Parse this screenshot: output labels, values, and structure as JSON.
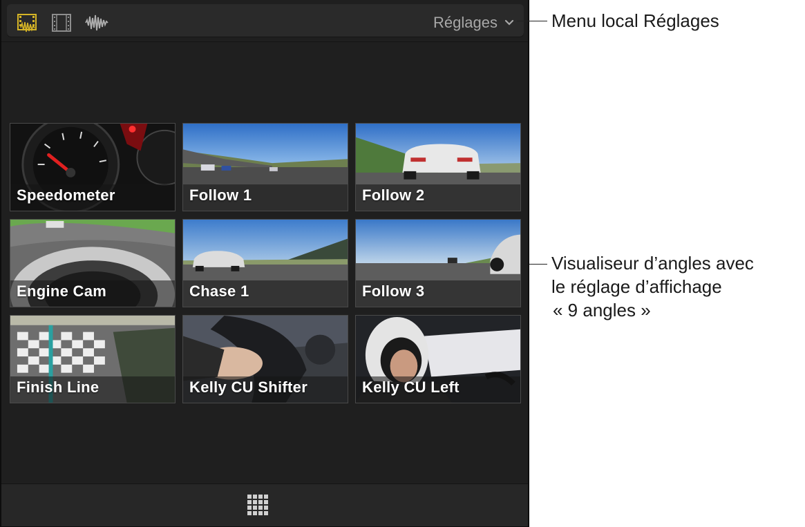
{
  "toolbar": {
    "icons": [
      "video-audio-icon",
      "video-only-icon",
      "audio-only-icon"
    ],
    "settings_label": "Réglages",
    "accent_color": "#d6b526"
  },
  "angles": [
    {
      "name": "Speedometer"
    },
    {
      "name": "Follow 1"
    },
    {
      "name": "Follow 2"
    },
    {
      "name": "Engine Cam"
    },
    {
      "name": "Chase 1"
    },
    {
      "name": "Follow 3"
    },
    {
      "name": "Finish Line"
    },
    {
      "name": "Kelly CU Shifter"
    },
    {
      "name": "Kelly CU Left"
    }
  ],
  "bottom_bar": {
    "icon": "grid-icon"
  },
  "callouts": {
    "settings_menu": "Menu local Réglages",
    "viewer_line1": "Visualiseur d’angles avec",
    "viewer_line2": "le réglage d’affichage",
    "viewer_line3": "« 9 angles »"
  }
}
